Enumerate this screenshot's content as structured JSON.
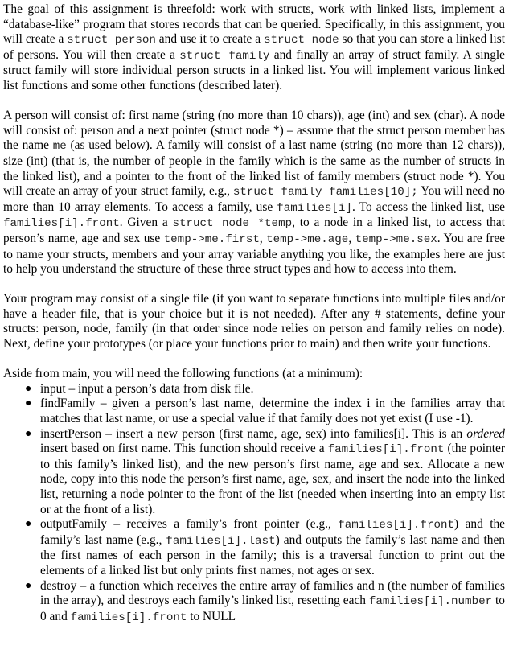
{
  "document": {
    "paragraphs": [
      {
        "id": "goal",
        "segments": [
          {
            "t": "The goal of this assignment is threefold:  work with structs, work with linked lists, implement a “database-like” program that stores records that can be queried.  Specifically, in this assignment, you will create a "
          },
          {
            "c": "struct person"
          },
          {
            "t": " and use it to create a "
          },
          {
            "c": "struct node"
          },
          {
            "t": " so that you can store a linked list of persons.  You will then create a "
          },
          {
            "c": "struct  family"
          },
          {
            "t": " and finally an array of struct family.  A single struct family will store individual person structs in a linked list.  You will implement various linked list functions and some other functions (described later)."
          }
        ]
      },
      {
        "id": "structs",
        "segments": [
          {
            "t": "A person will consist of:  first name (string (no more than 10 chars)), age (int) and sex (char).  A node will consist of: person and a next pointer (struct node *) – assume that the struct person member has the name "
          },
          {
            "c": "me"
          },
          {
            "t": "  (as used below).  A family will consist of a last name (string (no more than 12 chars)), size (int) (that is, the number of people in the family which is the same as the number of structs in the linked list), and a pointer to the front of the linked list of family members (struct node *).  You will create an array of your struct family, e.g., "
          },
          {
            "c": "struct  family families[10];"
          },
          {
            "t": "  You will need no more than 10 array elements. To access a family, use "
          },
          {
            "c": "families[i]"
          },
          {
            "t": ". To access the linked list, use "
          },
          {
            "c": "families[i].front"
          },
          {
            "t": ". Given a "
          },
          {
            "c": "struct node *temp"
          },
          {
            "t": ", to a node in a linked list, to access that person’s name, age and sex use "
          },
          {
            "c": "temp->me.first"
          },
          {
            "t": ", "
          },
          {
            "c": "temp->me.age"
          },
          {
            "t": ", "
          },
          {
            "c": "temp->me.sex"
          },
          {
            "t": ".  You are free to name your structs, members and your array variable anything you like, the examples here are just to help you understand the structure of these three struct types and how to access into them."
          }
        ]
      },
      {
        "id": "program",
        "segments": [
          {
            "t": "Your program may consist of a single file (if you want to separate functions into multiple files and/or have a header file, that is your choice but it is not needed).  After any # statements, define your structs:  person, node, family (in that order since node relies on person and family relies on node).  Next, define your prototypes (or place your functions prior to main) and then write your functions."
          }
        ]
      },
      {
        "id": "functions-intro",
        "segments": [
          {
            "t": "Aside from main, you will need the following functions (at a minimum):"
          }
        ]
      }
    ],
    "functions": [
      {
        "name": "input",
        "segments": [
          {
            "t": "input – input a person’s data from disk file."
          }
        ]
      },
      {
        "name": "findFamily",
        "segments": [
          {
            "t": "findFamily – given a person’s last name, determine the index i in the families array that matches that last name, or use a special value if that family does not yet exist (I use -1)."
          }
        ]
      },
      {
        "name": "insertPerson",
        "segments": [
          {
            "t": "insertPerson – insert a new person (first name, age, sex) into families[i].  This is an "
          },
          {
            "e": "ordered"
          },
          {
            "t": " insert based on first name.  This function should receive a "
          },
          {
            "c": "families[i].front"
          },
          {
            "t": " (the pointer to this family’s linked list), and the new person’s first name, age and sex.  Allocate a new node, copy into this node the person’s first name, age, sex, and insert the node into the linked list, returning a node pointer to the front of the list (needed when inserting into an empty list or at the front of a list)."
          }
        ]
      },
      {
        "name": "outputFamily",
        "segments": [
          {
            "t": "outputFamily – receives a family’s front pointer (e.g., "
          },
          {
            "c": "families[i].front"
          },
          {
            "t": ") and the family’s last name (e.g., "
          },
          {
            "c": "families[i].last"
          },
          {
            "t": ") and outputs the family’s last name and then the first names of each person in the family; this is a traversal function to print out the elements of a linked list but only prints first names, not ages or sex."
          }
        ]
      },
      {
        "name": "destroy",
        "segments": [
          {
            "t": "destroy – a function which receives the entire array of families and n (the number of families in the array), and destroys each family’s linked list, resetting each "
          },
          {
            "c": "families[i].number"
          },
          {
            "t": " to 0 and "
          },
          {
            "c": "families[i].front"
          },
          {
            "t": " to NULL"
          }
        ]
      }
    ],
    "bullet_glyph": "●"
  }
}
